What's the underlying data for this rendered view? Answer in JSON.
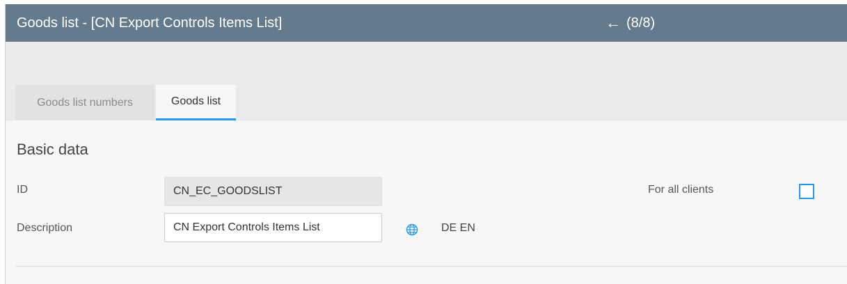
{
  "header": {
    "title": "Goods list - [CN Export Controls Items List]",
    "back_icon": "left-arrow",
    "counter": "(8/8)"
  },
  "tabs": [
    {
      "label": "Goods list numbers",
      "active": false
    },
    {
      "label": "Goods list",
      "active": true
    }
  ],
  "section": {
    "title": "Basic data"
  },
  "form": {
    "id_label": "ID",
    "id_value": "CN_EC_GOODSLIST",
    "description_label": "Description",
    "description_value": "CN Export Controls Items List",
    "language_icon": "globe-icon",
    "language_codes": "DE EN",
    "for_all_clients_label": "For all clients",
    "for_all_clients_checked": false
  },
  "colors": {
    "title_bar": "#637b8c",
    "accent": "#2196f3"
  }
}
